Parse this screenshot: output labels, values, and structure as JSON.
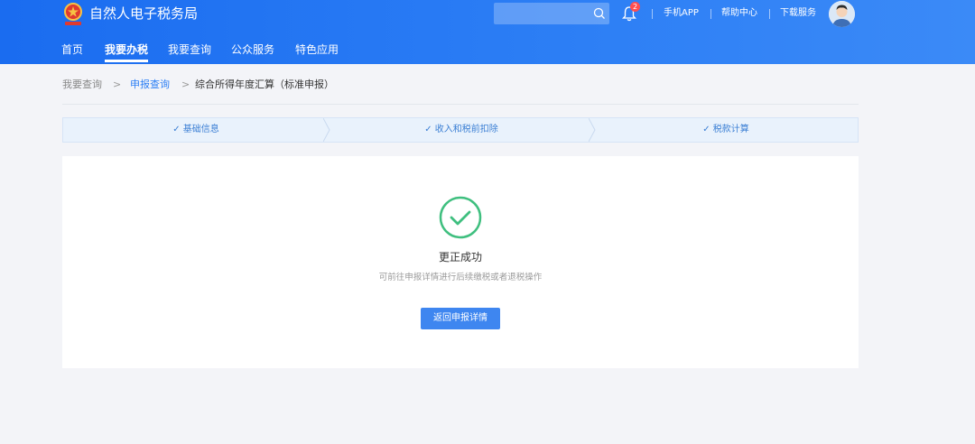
{
  "header": {
    "site_title": "自然人电子税务局",
    "logo_icon": "tax-emblem-icon",
    "search": {
      "placeholder": "",
      "icon": "search-icon"
    },
    "notifications": {
      "icon": "bell-icon",
      "count": "2"
    },
    "links": [
      "手机APP",
      "帮助中心",
      "下载服务"
    ],
    "avatar_icon": "user-avatar-icon"
  },
  "nav": {
    "items": [
      "首页",
      "我要办税",
      "我要查询",
      "公众服务",
      "特色应用"
    ],
    "active_index": 1
  },
  "breadcrumb": {
    "items": [
      "我要查询",
      "申报查询",
      "综合所得年度汇算（标准申报）"
    ],
    "separator": ">"
  },
  "steps": {
    "items": [
      "✓ 基础信息",
      "✓ 收入和税前扣除",
      "✓ 税款计算"
    ]
  },
  "result": {
    "icon": "check-circle-icon",
    "title": "更正成功",
    "description": "可前往申报详情进行后续缴税或者退税操作",
    "button_label": "返回申报详情"
  },
  "colors": {
    "header_blue": "#1a6cf0",
    "accent": "#2d7ff5",
    "success": "#3fbf7f",
    "badge": "#ff4d4f"
  }
}
